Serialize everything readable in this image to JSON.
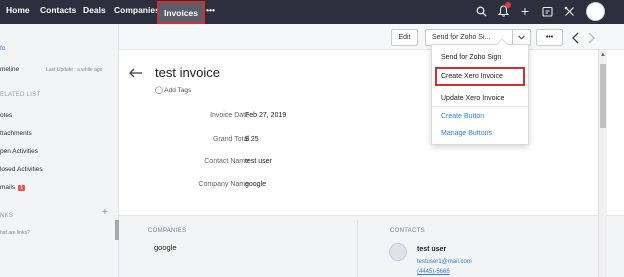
{
  "nav": {
    "items": [
      "Home",
      "Contacts",
      "Deals",
      "Companies"
    ],
    "active": "Invoices",
    "more": "•••",
    "notification_count": "1"
  },
  "sidebar": {
    "info": "fo",
    "timeline": "meline",
    "last_update": "Last Update : a while ago",
    "related_list": "ELATED LIST",
    "items": [
      "otes",
      "ttachments",
      "pen Activities",
      "losed Activities",
      "mails"
    ],
    "emails_badge": "1",
    "links_section": "NKS",
    "add": "+",
    "links_hint": "hat are links?"
  },
  "toolbar": {
    "edit": "Edit",
    "send_for_zoho": "Send for Zoho Si...",
    "more": "•••"
  },
  "record": {
    "title": "test invoice",
    "add_tags": "Add Tags",
    "fields": [
      {
        "label": "Invoice Date",
        "value": "Feb 27, 2019"
      },
      {
        "label": "Grand Total",
        "value": "$ 25"
      },
      {
        "label": "Contact Name",
        "value": "test user"
      },
      {
        "label": "Company Name",
        "value": "google"
      }
    ]
  },
  "bottom": {
    "companies_header": "COMPANIES",
    "company": "google",
    "contacts_header": "CONTACTS",
    "contact_name": "test user",
    "contact_email": "testuser1@mail.com",
    "contact_phone": "(4445)-5666"
  },
  "dropdown": {
    "items": [
      "Send for Zoho Sign",
      "Create Xero Invoice",
      "Update Xero Invoice"
    ],
    "links": [
      "Create Button",
      "Manage Buttons"
    ]
  },
  "colors": {
    "nav_bg": "#2b2f3e",
    "highlight": "#d32f2f",
    "link": "#2f80ed",
    "badge": "#f05454"
  },
  "icons": [
    "search-icon",
    "bell-icon",
    "plus-icon",
    "calendar-icon",
    "tools-icon",
    "avatar",
    "chevron-down-icon",
    "chevron-left-icon",
    "chevron-right-icon",
    "arrow-left-icon",
    "tag-icon"
  ]
}
